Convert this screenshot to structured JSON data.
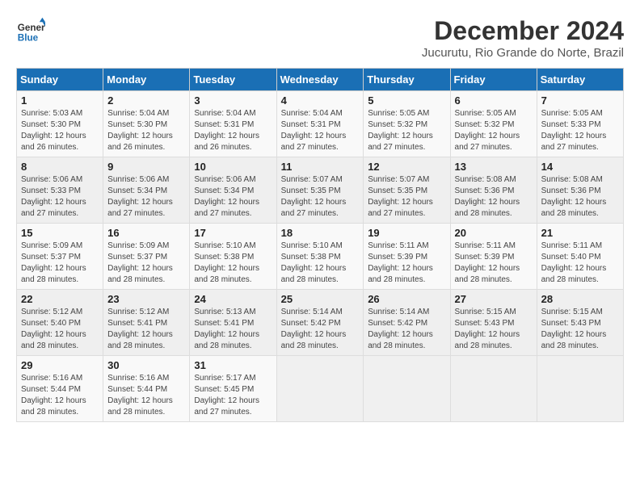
{
  "logo": {
    "line1": "General",
    "line2": "Blue"
  },
  "title": "December 2024",
  "subtitle": "Jucurutu, Rio Grande do Norte, Brazil",
  "weekdays": [
    "Sunday",
    "Monday",
    "Tuesday",
    "Wednesday",
    "Thursday",
    "Friday",
    "Saturday"
  ],
  "weeks": [
    [
      {
        "day": "1",
        "info": "Sunrise: 5:03 AM\nSunset: 5:30 PM\nDaylight: 12 hours\nand 26 minutes."
      },
      {
        "day": "2",
        "info": "Sunrise: 5:04 AM\nSunset: 5:30 PM\nDaylight: 12 hours\nand 26 minutes."
      },
      {
        "day": "3",
        "info": "Sunrise: 5:04 AM\nSunset: 5:31 PM\nDaylight: 12 hours\nand 26 minutes."
      },
      {
        "day": "4",
        "info": "Sunrise: 5:04 AM\nSunset: 5:31 PM\nDaylight: 12 hours\nand 27 minutes."
      },
      {
        "day": "5",
        "info": "Sunrise: 5:05 AM\nSunset: 5:32 PM\nDaylight: 12 hours\nand 27 minutes."
      },
      {
        "day": "6",
        "info": "Sunrise: 5:05 AM\nSunset: 5:32 PM\nDaylight: 12 hours\nand 27 minutes."
      },
      {
        "day": "7",
        "info": "Sunrise: 5:05 AM\nSunset: 5:33 PM\nDaylight: 12 hours\nand 27 minutes."
      }
    ],
    [
      {
        "day": "8",
        "info": "Sunrise: 5:06 AM\nSunset: 5:33 PM\nDaylight: 12 hours\nand 27 minutes."
      },
      {
        "day": "9",
        "info": "Sunrise: 5:06 AM\nSunset: 5:34 PM\nDaylight: 12 hours\nand 27 minutes."
      },
      {
        "day": "10",
        "info": "Sunrise: 5:06 AM\nSunset: 5:34 PM\nDaylight: 12 hours\nand 27 minutes."
      },
      {
        "day": "11",
        "info": "Sunrise: 5:07 AM\nSunset: 5:35 PM\nDaylight: 12 hours\nand 27 minutes."
      },
      {
        "day": "12",
        "info": "Sunrise: 5:07 AM\nSunset: 5:35 PM\nDaylight: 12 hours\nand 27 minutes."
      },
      {
        "day": "13",
        "info": "Sunrise: 5:08 AM\nSunset: 5:36 PM\nDaylight: 12 hours\nand 28 minutes."
      },
      {
        "day": "14",
        "info": "Sunrise: 5:08 AM\nSunset: 5:36 PM\nDaylight: 12 hours\nand 28 minutes."
      }
    ],
    [
      {
        "day": "15",
        "info": "Sunrise: 5:09 AM\nSunset: 5:37 PM\nDaylight: 12 hours\nand 28 minutes."
      },
      {
        "day": "16",
        "info": "Sunrise: 5:09 AM\nSunset: 5:37 PM\nDaylight: 12 hours\nand 28 minutes."
      },
      {
        "day": "17",
        "info": "Sunrise: 5:10 AM\nSunset: 5:38 PM\nDaylight: 12 hours\nand 28 minutes."
      },
      {
        "day": "18",
        "info": "Sunrise: 5:10 AM\nSunset: 5:38 PM\nDaylight: 12 hours\nand 28 minutes."
      },
      {
        "day": "19",
        "info": "Sunrise: 5:11 AM\nSunset: 5:39 PM\nDaylight: 12 hours\nand 28 minutes."
      },
      {
        "day": "20",
        "info": "Sunrise: 5:11 AM\nSunset: 5:39 PM\nDaylight: 12 hours\nand 28 minutes."
      },
      {
        "day": "21",
        "info": "Sunrise: 5:11 AM\nSunset: 5:40 PM\nDaylight: 12 hours\nand 28 minutes."
      }
    ],
    [
      {
        "day": "22",
        "info": "Sunrise: 5:12 AM\nSunset: 5:40 PM\nDaylight: 12 hours\nand 28 minutes."
      },
      {
        "day": "23",
        "info": "Sunrise: 5:12 AM\nSunset: 5:41 PM\nDaylight: 12 hours\nand 28 minutes."
      },
      {
        "day": "24",
        "info": "Sunrise: 5:13 AM\nSunset: 5:41 PM\nDaylight: 12 hours\nand 28 minutes."
      },
      {
        "day": "25",
        "info": "Sunrise: 5:14 AM\nSunset: 5:42 PM\nDaylight: 12 hours\nand 28 minutes."
      },
      {
        "day": "26",
        "info": "Sunrise: 5:14 AM\nSunset: 5:42 PM\nDaylight: 12 hours\nand 28 minutes."
      },
      {
        "day": "27",
        "info": "Sunrise: 5:15 AM\nSunset: 5:43 PM\nDaylight: 12 hours\nand 28 minutes."
      },
      {
        "day": "28",
        "info": "Sunrise: 5:15 AM\nSunset: 5:43 PM\nDaylight: 12 hours\nand 28 minutes."
      }
    ],
    [
      {
        "day": "29",
        "info": "Sunrise: 5:16 AM\nSunset: 5:44 PM\nDaylight: 12 hours\nand 28 minutes."
      },
      {
        "day": "30",
        "info": "Sunrise: 5:16 AM\nSunset: 5:44 PM\nDaylight: 12 hours\nand 28 minutes."
      },
      {
        "day": "31",
        "info": "Sunrise: 5:17 AM\nSunset: 5:45 PM\nDaylight: 12 hours\nand 27 minutes."
      },
      {
        "day": "",
        "info": ""
      },
      {
        "day": "",
        "info": ""
      },
      {
        "day": "",
        "info": ""
      },
      {
        "day": "",
        "info": ""
      }
    ]
  ]
}
